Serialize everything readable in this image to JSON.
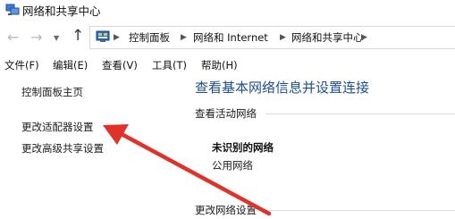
{
  "window": {
    "title": "网络和共享中心"
  },
  "address": {
    "breadcrumbs": [
      "控制面板",
      "网络和 Internet",
      "网络和共享中心"
    ]
  },
  "menu": {
    "file": "文件(F)",
    "edit": "编辑(E)",
    "view": "查看(V)",
    "tools": "工具(T)",
    "help": "帮助(H)"
  },
  "sidebar": {
    "items": [
      "控制面板主页",
      "更改适配器设置",
      "更改高级共享设置"
    ]
  },
  "main": {
    "heading": "查看基本网络信息并设置连接",
    "active_networks_label": "查看活动网络",
    "network_name": "未识别的网络",
    "network_type": "公用网络",
    "change_settings_label": "更改网络设置"
  },
  "colors": {
    "heading": "#1e4e8c",
    "annotation_arrow": "#e0312b"
  },
  "icons": {
    "title": "network-center-icon",
    "back": "back-arrow-icon",
    "forward": "forward-arrow-icon",
    "recent": "chevron-down-icon",
    "up": "up-arrow-icon",
    "address": "control-panel-icon"
  }
}
